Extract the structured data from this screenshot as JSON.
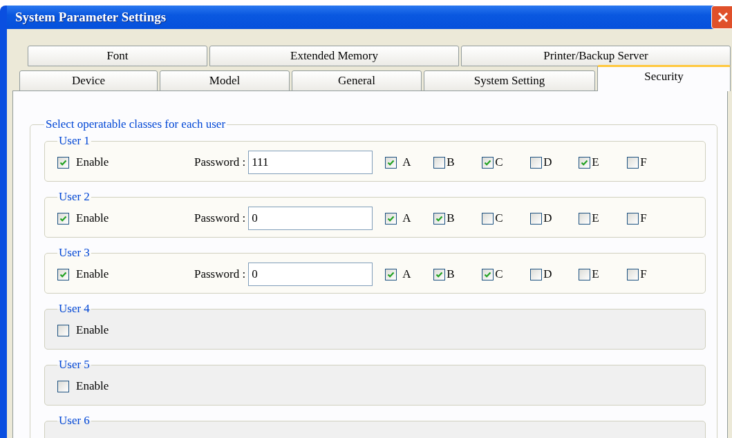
{
  "window": {
    "title": "System Parameter Settings"
  },
  "tab_rows": [
    [
      {
        "label": "Font",
        "selected": false
      },
      {
        "label": "Extended Memory",
        "selected": false
      },
      {
        "label": "Printer/Backup Server",
        "selected": false
      }
    ],
    [
      {
        "label": "Device",
        "selected": false
      },
      {
        "label": "Model",
        "selected": false
      },
      {
        "label": "General",
        "selected": false
      },
      {
        "label": "System Setting",
        "selected": false
      },
      {
        "label": "Security",
        "selected": true
      }
    ]
  ],
  "group": {
    "title": "Select operatable classes for each user",
    "users": [
      {
        "label": "User 1",
        "enable_label": "Enable",
        "enabled": true,
        "password_label": "Password :",
        "password": "111",
        "classes": [
          {
            "label": "A",
            "checked": true
          },
          {
            "label": "B",
            "checked": false
          },
          {
            "label": "C",
            "checked": true
          },
          {
            "label": "D",
            "checked": false
          },
          {
            "label": "E",
            "checked": true
          },
          {
            "label": "F",
            "checked": false
          }
        ]
      },
      {
        "label": "User 2",
        "enable_label": "Enable",
        "enabled": true,
        "password_label": "Password :",
        "password": "0",
        "classes": [
          {
            "label": "A",
            "checked": true
          },
          {
            "label": "B",
            "checked": true
          },
          {
            "label": "C",
            "checked": false
          },
          {
            "label": "D",
            "checked": false
          },
          {
            "label": "E",
            "checked": false
          },
          {
            "label": "F",
            "checked": false
          }
        ]
      },
      {
        "label": "User 3",
        "enable_label": "Enable",
        "enabled": true,
        "password_label": "Password :",
        "password": "0",
        "classes": [
          {
            "label": "A",
            "checked": true
          },
          {
            "label": "B",
            "checked": true
          },
          {
            "label": "C",
            "checked": true
          },
          {
            "label": "D",
            "checked": false
          },
          {
            "label": "E",
            "checked": false
          },
          {
            "label": "F",
            "checked": false
          }
        ]
      },
      {
        "label": "User 4",
        "enable_label": "Enable",
        "enabled": false
      },
      {
        "label": "User 5",
        "enable_label": "Enable",
        "enabled": false
      },
      {
        "label": "User 6"
      }
    ]
  }
}
